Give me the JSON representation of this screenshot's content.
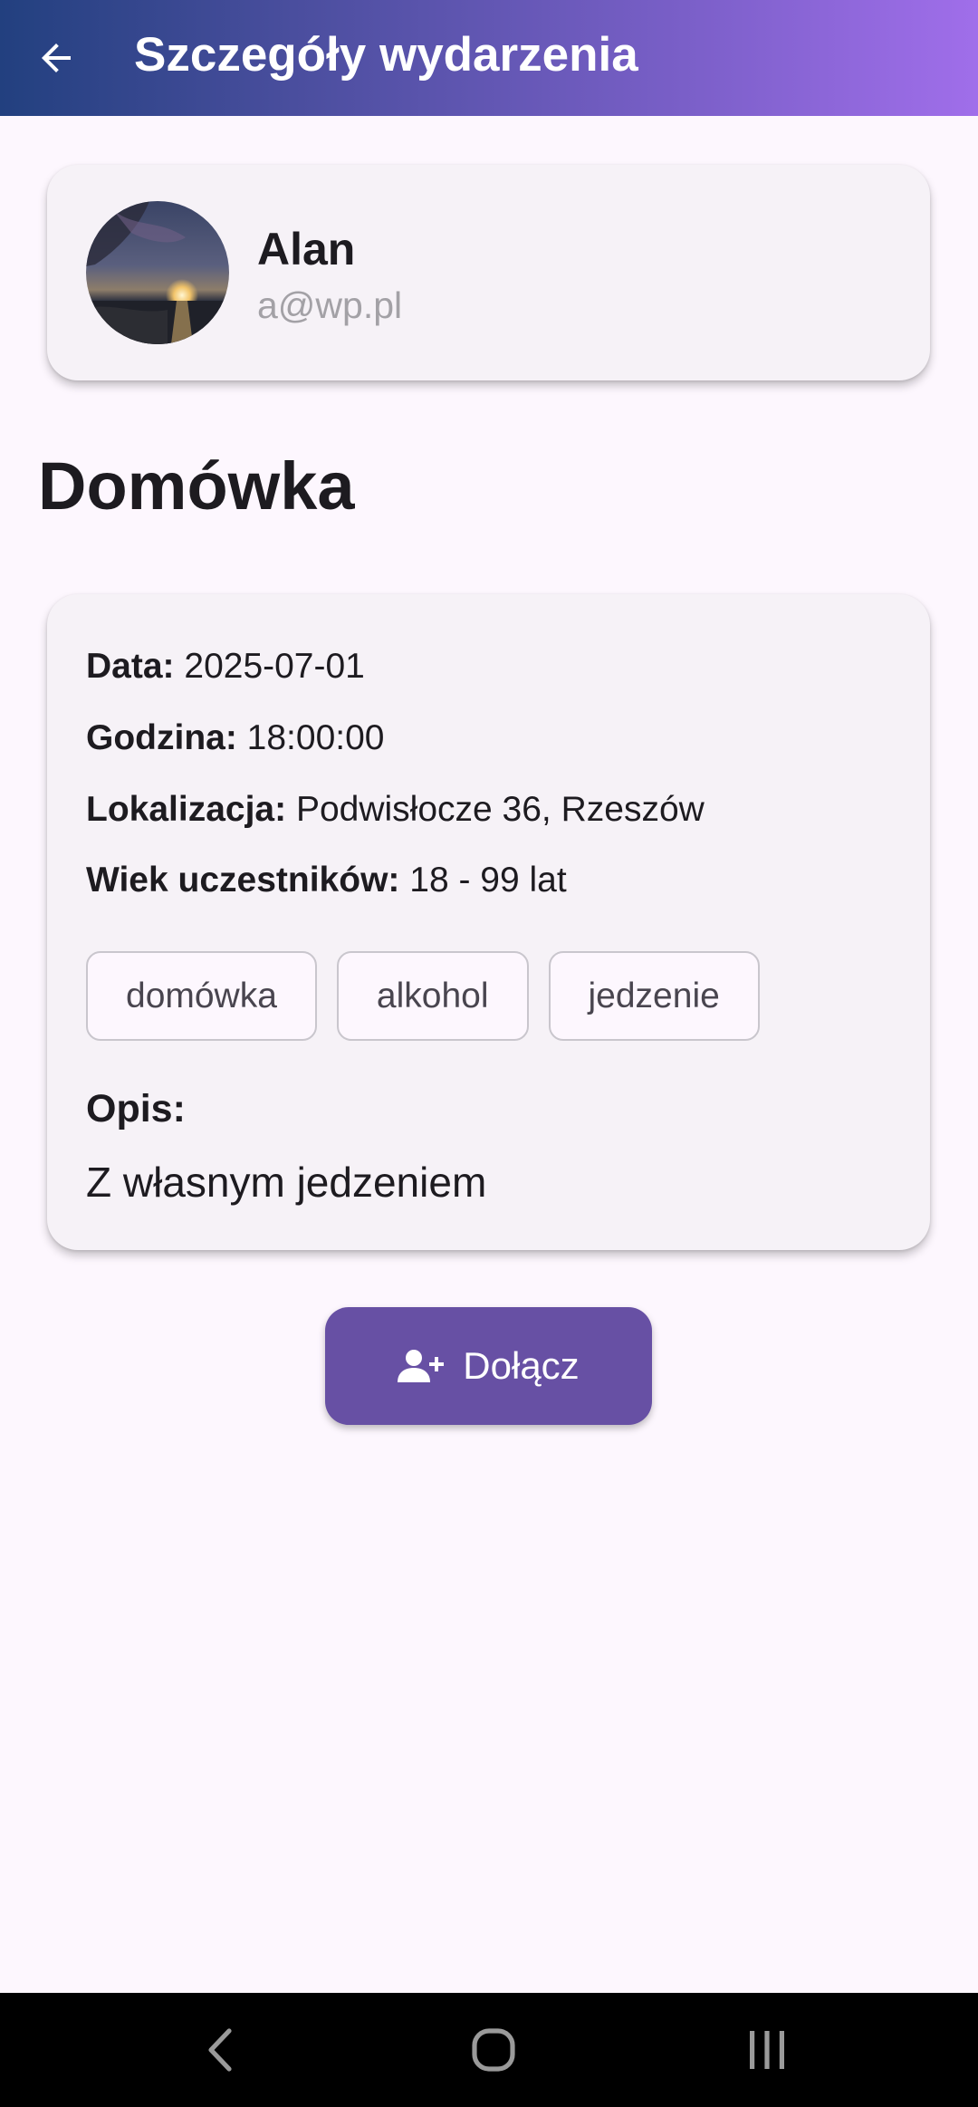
{
  "app_bar": {
    "title": "Szczegóły wydarzenia",
    "back_icon": "arrow-left-icon"
  },
  "organizer": {
    "name": "Alan",
    "email": "a@wp.pl",
    "avatar_icon": "avatar-photo"
  },
  "event": {
    "title": "Domówka",
    "details": {
      "date_label": "Data:",
      "date_value": "2025-07-01",
      "time_label": "Godzina:",
      "time_value": "18:00:00",
      "location_label": "Lokalizacja:",
      "location_value": "Podwisłocze 36, Rzeszów",
      "age_label": "Wiek uczestników:",
      "age_value": "18 - 99 lat"
    },
    "tags": [
      "domówka",
      "alkohol",
      "jedzenie"
    ],
    "description_label": "Opis:",
    "description": "Z własnym jedzeniem"
  },
  "join_button": {
    "label": "Dołącz",
    "icon": "person-add-icon"
  },
  "system_nav": {
    "back_icon": "nav-back-icon",
    "home_icon": "nav-home-icon",
    "recents_icon": "nav-recents-icon"
  },
  "colors": {
    "primary": "#6750a4",
    "background": "#fdf7fe",
    "card": "#f6f2f7",
    "appbar_gradient_start": "#22407f",
    "appbar_gradient_end": "#a06eea"
  }
}
